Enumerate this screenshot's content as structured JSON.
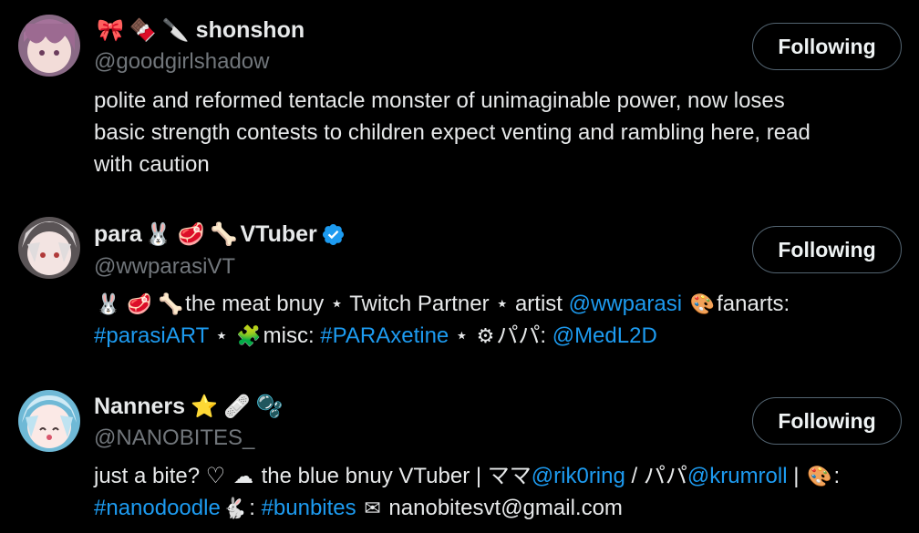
{
  "users": [
    {
      "name_emojis": [
        "🎀",
        "🍫",
        "🔪"
      ],
      "name": "shonshon",
      "handle": "@goodgirlshadow",
      "follow_label": "Following",
      "bio_lines": [
        "polite and reformed tentacle monster of unimaginable power, now loses",
        "basic strength contests to children expect venting and rambling here, read",
        "with caution"
      ],
      "avatar_color": "#b58fa3"
    },
    {
      "name_prefix": "para",
      "name_emojis": [
        "🐰",
        "🥩",
        "🦴"
      ],
      "name": "VTuber",
      "verified": true,
      "handle": "@wwparasiVT",
      "follow_label": "Following",
      "bio": {
        "l1_emojis": "🐰 🥩 🦴",
        "l1_text1": "the meat bnuy ⋆ Twitch Partner ⋆ artist ",
        "l1_link1": "@wwparasi",
        "l1_emoji2": "🎨",
        "l1_text2": "fanarts:",
        "l2_link1": "#parasiART",
        "l2_text1": " ⋆ ",
        "l2_emoji1": "🧩",
        "l2_text2": "misc: ",
        "l2_link2": "#PARAxetine",
        "l2_text3": " ⋆ ",
        "l2_emoji2": "⚙",
        "l2_text4": "パパ: ",
        "l2_link3": "@MedL2D"
      },
      "avatar_color": "#c9c4c6"
    },
    {
      "name": "Nanners",
      "name_emojis": [
        "⭐",
        "🩹",
        "🫧"
      ],
      "handle": "@NANOBITES_",
      "follow_label": "Following",
      "bio": {
        "l1_text1": "just a bite? ♡ ",
        "l1_emoji1": "☁",
        "l1_text2": " the blue bnuy VTuber | ママ",
        "l1_link1": "@rik0ring",
        "l1_text3": " / パパ",
        "l1_link2": "@krumroll",
        "l1_text4": " | ",
        "l1_emoji2": "🎨",
        "l1_text5": ":",
        "l2_link1": "#nanodoodle",
        "l2_emoji1": "🐇",
        "l2_text1": ": ",
        "l2_link2": "#bunbites",
        "l2_emoji2": "✉",
        "l2_text2": " nanobitesvt@gmail.com"
      },
      "avatar_color": "#aee0f0"
    }
  ],
  "colors": {
    "background": "#000000",
    "text": "#e7e9ea",
    "secondary": "#71767b",
    "link": "#1d9bf0",
    "button_border": "#536471"
  }
}
